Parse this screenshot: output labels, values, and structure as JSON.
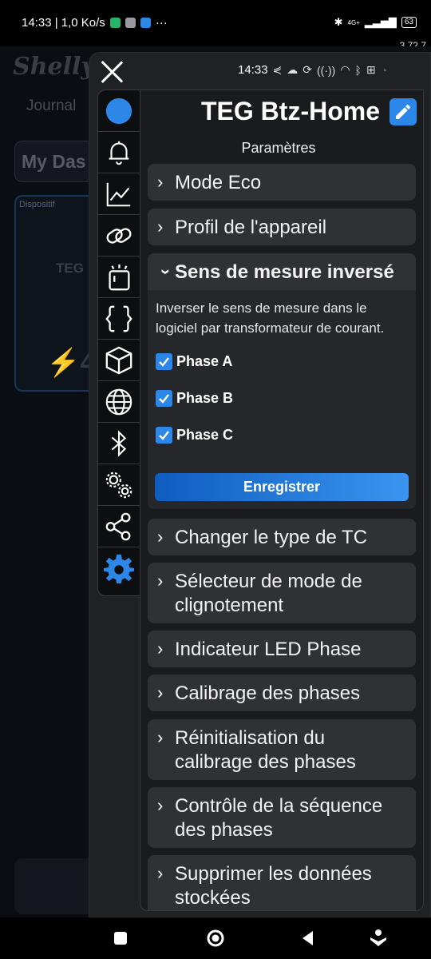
{
  "status_bar": {
    "left_text": "14:33 | 1,0 Ko/s",
    "more": "···",
    "network": "4G+",
    "battery": "63"
  },
  "version": "3.72.7",
  "background_app": {
    "logo": "Shelly",
    "tab": "Journal",
    "dashboard": "My Das",
    "card_label": "Dispositif",
    "card_title": "TEG",
    "card_value": "⚡4"
  },
  "panel": {
    "time": "14:33",
    "title": "TEG Btz-Home",
    "subtitle": "Paramètres",
    "sidebar_icons": [
      "status-icon",
      "bell-icon",
      "chart-icon",
      "link-icon",
      "alert-box-icon",
      "code-braces-icon",
      "cube-icon",
      "globe-icon",
      "bluetooth-icon",
      "gears-icon",
      "share-icon",
      "settings-icon"
    ],
    "sections": [
      {
        "label": "Mode Eco"
      },
      {
        "label": "Profil de l'appareil"
      },
      {
        "label": "Sens de mesure inversé",
        "open": true,
        "description": "Inverser le sens de mesure dans le logiciel par transformateur de courant.",
        "checkboxes": [
          {
            "label": "Phase A",
            "checked": true
          },
          {
            "label": "Phase B",
            "checked": true
          },
          {
            "label": "Phase C",
            "checked": true
          }
        ],
        "save_label": "Enregistrer"
      },
      {
        "label": "Changer le type de TC"
      },
      {
        "label": "Sélecteur de mode de clignotement"
      },
      {
        "label": "Indicateur LED Phase"
      },
      {
        "label": "Calibrage des phases"
      },
      {
        "label": "Réinitialisation du calibrage des phases"
      },
      {
        "label": "Contrôle de la séquence des phases"
      },
      {
        "label": "Supprimer les données stockées"
      }
    ]
  },
  "colors": {
    "accent": "#2d87e8",
    "panel_bg": "#202124",
    "section_bg": "#303134"
  }
}
